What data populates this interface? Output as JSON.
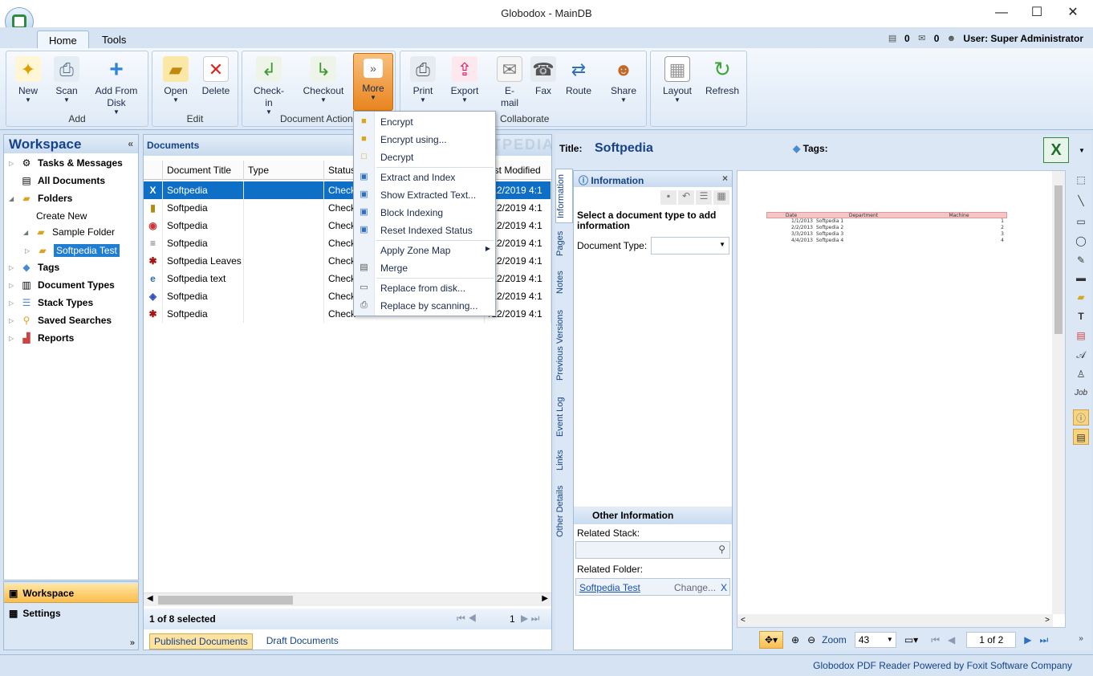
{
  "window": {
    "title": "Globodox - MainDB",
    "minimize": "—",
    "maximize": "☐",
    "close": "✕"
  },
  "ribbon_tabs": [
    "Home",
    "Tools"
  ],
  "user": {
    "tasks_count": "0",
    "mail_count": "0",
    "label": "User: Super Administrator"
  },
  "ribbon": {
    "add": {
      "label": "Add",
      "new": "New",
      "scan": "Scan",
      "add_from": "Add From",
      "disk": "Disk"
    },
    "edit": {
      "label": "Edit",
      "open": "Open",
      "delete": "Delete"
    },
    "doc_actions": {
      "label": "Document Actions",
      "checkin": "Check-",
      "checkin2": "in",
      "checkout": "Checkout",
      "more": "More"
    },
    "collaborate": {
      "label": "Collaborate",
      "print": "Print",
      "export": "Export",
      "email": "E-",
      "email2": "mail",
      "fax": "Fax",
      "route": "Route",
      "share": "Share"
    },
    "view": {
      "layout": "Layout",
      "refresh": "Refresh"
    }
  },
  "workspace": {
    "title": "Workspace",
    "tree": {
      "tasks": "Tasks & Messages",
      "all_docs": "All Documents",
      "folders": "Folders",
      "create_new": "Create New",
      "sample_folder": "Sample Folder",
      "softpedia_test": "Softpedia Test",
      "tags": "Tags",
      "doc_types": "Document Types",
      "stack_types": "Stack Types",
      "saved_searches": "Saved Searches",
      "reports": "Reports"
    },
    "nav": {
      "workspace": "Workspace",
      "settings": "Settings"
    }
  },
  "documents": {
    "title": "Documents",
    "columns": [
      "Document Title",
      "Type",
      "Status",
      "ast Modified O"
    ],
    "rows": [
      {
        "icon": "X",
        "title": "Softpedia",
        "type": "",
        "status": "Check",
        "date": "/12/2019  4:1"
      },
      {
        "icon": "▮",
        "title": "Softpedia",
        "type": "",
        "status": "Check",
        "date": "/12/2019  4:1"
      },
      {
        "icon": "◉",
        "title": "Softpedia",
        "type": "",
        "status": "Check",
        "date": "/12/2019  4:1"
      },
      {
        "icon": "≡",
        "title": "Softpedia",
        "type": "",
        "status": "Check",
        "date": "/12/2019  4:1"
      },
      {
        "icon": "✱",
        "title": "Softpedia Leaves",
        "type": "",
        "status": "Check",
        "date": "/12/2019  4:1"
      },
      {
        "icon": "e",
        "title": "Softpedia text",
        "type": "",
        "status": "Check",
        "date": "/12/2019  4:1"
      },
      {
        "icon": "◈",
        "title": "Softpedia",
        "type": "",
        "status": "Check",
        "date": "/12/2019  4:1"
      },
      {
        "icon": "✱",
        "title": "Softpedia",
        "type": "",
        "status": "Check",
        "date": "/12/2019  4:1"
      }
    ],
    "footer": "1 of 8 selected",
    "page": "1",
    "tabs": {
      "published": "Published Documents",
      "draft": "Draft Documents"
    }
  },
  "more_menu": {
    "items": [
      "Encrypt",
      "Encrypt using...",
      "Decrypt",
      "Extract and Index",
      "Show Extracted Text...",
      "Block Indexing",
      "Reset Indexed Status",
      "Apply Zone Map",
      "Merge",
      "Replace from disk...",
      "Replace by scanning..."
    ]
  },
  "details": {
    "title_label": "Title:",
    "title_value": "Softpedia",
    "tags_label": "Tags:",
    "vtabs": [
      "Information",
      "Pages",
      "Notes",
      "Previous Versions",
      "Event Log",
      "Links",
      "Other Details"
    ],
    "info_title": "Information",
    "info_prompt": "Select a document type to add information",
    "doc_type_label": "Document Type:",
    "other_info": "Other Information",
    "related_stack": "Related Stack:",
    "related_folder": "Related Folder:",
    "folder_link": "Softpedia Test",
    "change": "Change...",
    "remove": "X"
  },
  "pdf": {
    "headers": [
      "Date",
      "Department",
      "Machine"
    ],
    "rows": [
      [
        "1/1/2013",
        "Softpedia 1",
        "1"
      ],
      [
        "2/2/2013",
        "Softpedia 2",
        "2"
      ],
      [
        "3/3/2013",
        "Softpedia 3",
        "3"
      ],
      [
        "4/4/2013",
        "Softpedia 4",
        "4"
      ]
    ],
    "zoom_label": "Zoom",
    "zoom_value": "43",
    "page_indicator": "1 of 2"
  },
  "watermark": "SOFTPEDIA",
  "status_text": "Globodox PDF Reader Powered by Foxit Software Company"
}
